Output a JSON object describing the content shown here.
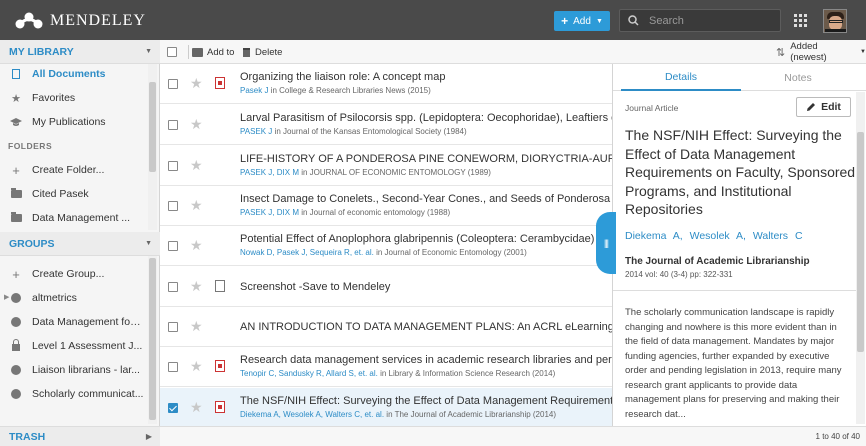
{
  "app": {
    "name": "MENDELEY"
  },
  "header": {
    "add_label": "Add",
    "search_placeholder": "Search"
  },
  "sidebar": {
    "my_library": "MY LIBRARY",
    "library_items": [
      {
        "label": "All Documents",
        "icon": "documents-icon"
      },
      {
        "label": "Favorites",
        "icon": "star-icon"
      },
      {
        "label": "My Publications",
        "icon": "graduation-cap-icon"
      }
    ],
    "folders_label": "FOLDERS",
    "folder_items": [
      {
        "label": "Create Folder...",
        "icon": "plus-icon"
      },
      {
        "label": "Cited Pasek",
        "icon": "folder-icon"
      },
      {
        "label": "Data Management ...",
        "icon": "folder-icon"
      }
    ],
    "groups": "GROUPS",
    "group_items": [
      {
        "label": "Create Group...",
        "icon": "plus-icon"
      },
      {
        "label": "altmetrics",
        "icon": "globe-icon"
      },
      {
        "label": "Data Management for ...",
        "icon": "globe-icon"
      },
      {
        "label": "Level 1 Assessment J...",
        "icon": "lock-icon"
      },
      {
        "label": "Liaison librarians - lar...",
        "icon": "globe-icon"
      },
      {
        "label": "Scholarly communicat...",
        "icon": "globe-icon"
      }
    ],
    "trash": "TRASH"
  },
  "toolbar": {
    "add_to": "Add to",
    "delete": "Delete",
    "sort": "Added (newest)"
  },
  "documents": [
    {
      "title": "Organizing the liaison role: A concept map",
      "authors": "Pasek J",
      "rest": " in College & Research Libraries News (2015)",
      "type": "pdf",
      "selected": false
    },
    {
      "title": "Larval Parasitism of Psilocorsis spp. (Lepidoptera: Oecophoridae), Leaftiers of Oaks in Southeast Kansas",
      "authors": "PASEK J",
      "rest": " in Journal of the Kansas Entomological Society (1984)",
      "type": "none",
      "selected": false
    },
    {
      "title": "LIFE-HISTORY OF A PONDEROSA PINE CONEWORM, DIORYCTRIA-AURANTIACELLA",
      "authors": "PASEK J, DIX M",
      "rest": " in JOURNAL OF ECONOMIC ENTOMOLOGY (1989)",
      "type": "none",
      "selected": false
    },
    {
      "title": "Insect Damage to Conelets., Second-Year Cones., and Seeds of Ponderosa Pine",
      "authors": "PASEK J, DIX M",
      "rest": " in Journal of economic entomology (1988)",
      "type": "none",
      "selected": false
    },
    {
      "title": "Potential Effect of Anoplophora glabripennis (Coleoptera: Cerambycidae) on Urban Trees",
      "authors": "Nowak D, Pasek J, Sequeira R, et. al.",
      "rest": " in Journal of Economic Entomology (2001)",
      "type": "none",
      "selected": false
    },
    {
      "title": "Screenshot -Save to Mendeley",
      "authors": "",
      "rest": "",
      "type": "doc",
      "selected": false
    },
    {
      "title": "AN INTRODUCTION TO DATA MANAGEMENT PLANS: An ACRL eLearning Webcast",
      "authors": "",
      "rest": "",
      "type": "none",
      "selected": false
    },
    {
      "title": "Research data management services in academic research libraries and perceptions of librarians",
      "authors": "Tenopir C, Sandusky R, Allard S, et. al.",
      "rest": " in Library & Information Science Research (2014)",
      "type": "pdf",
      "selected": false
    },
    {
      "title": "The NSF/NIH Effect: Surveying the Effect of Data Management Requirements on Faculty",
      "authors": "Diekema A, Wesolek A, Walters C, et. al.",
      "rest": " in The Journal of Academic Librarianship (2014)",
      "type": "pdf",
      "selected": true
    }
  ],
  "details": {
    "tab_details": "Details",
    "tab_notes": "Notes",
    "type": "Journal Article",
    "edit": "Edit",
    "title": "The NSF/NIH Effect: Surveying the Effect of Data Management Requirements on Faculty, Sponsored Programs, and Institutional Repositories",
    "authors": "Diekema A,  Wesolek A,  Walters C",
    "journal": "The Journal of Academic Librarianship",
    "volume": "2014 vol: 40 (3-4) pp: 322-331",
    "abstract": "The scholarly communication landscape is rapidly changing and nowhere is this more evident than in the field of data management. Mandates by major funding agencies, further expanded by executive order and pending legislation in 2013, require many research grant applicants to provide data management plans for preserving and making their research dat..."
  },
  "footer": {
    "count": "1 to 40 of 40"
  },
  "colors": {
    "accent": "#2d8cc6",
    "topbar": "#4a4a4a",
    "add_button": "#2d9bd8"
  }
}
